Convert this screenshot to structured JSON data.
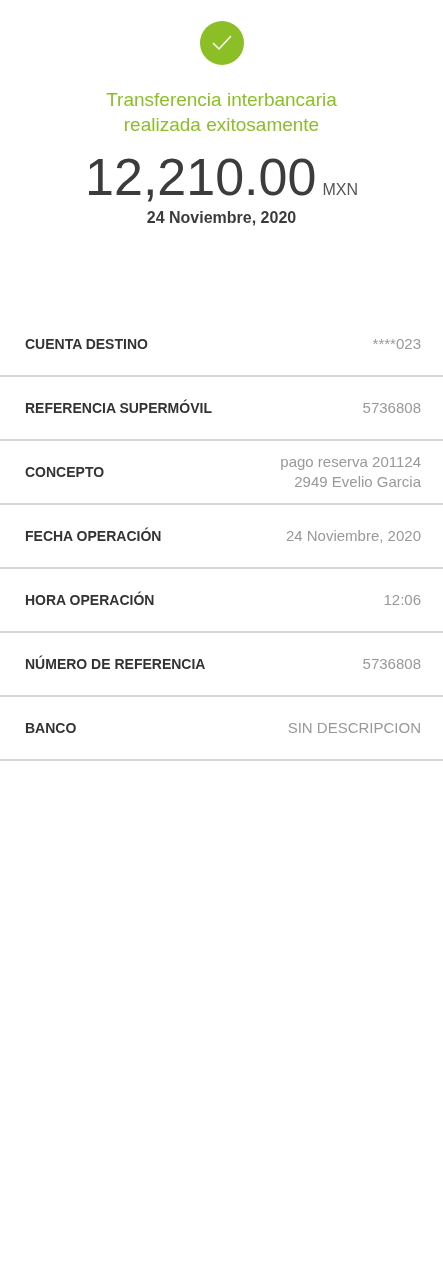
{
  "status": {
    "success": true,
    "message": "Transferencia interbancaria realizada exitosamente"
  },
  "amount": {
    "value": "12,210.00",
    "currency": "MXN"
  },
  "date": "24 Noviembre, 2020",
  "details": [
    {
      "label": "CUENTA DESTINO",
      "value": [
        "****023"
      ]
    },
    {
      "label": "REFERENCIA SUPERMÓVIL",
      "value": [
        "5736808"
      ]
    },
    {
      "label": "CONCEPTO",
      "value": [
        "pago reserva 201124",
        "2949 Evelio Garcia"
      ]
    },
    {
      "label": "FECHA OPERACIÓN",
      "value": [
        "24 Noviembre, 2020"
      ]
    },
    {
      "label": "HORA OPERACIÓN",
      "value": [
        "12:06"
      ]
    },
    {
      "label": "NÚMERO DE REFERENCIA",
      "value": [
        "5736808"
      ]
    },
    {
      "label": "BANCO",
      "value": [
        "SIN DESCRIPCION"
      ]
    }
  ]
}
